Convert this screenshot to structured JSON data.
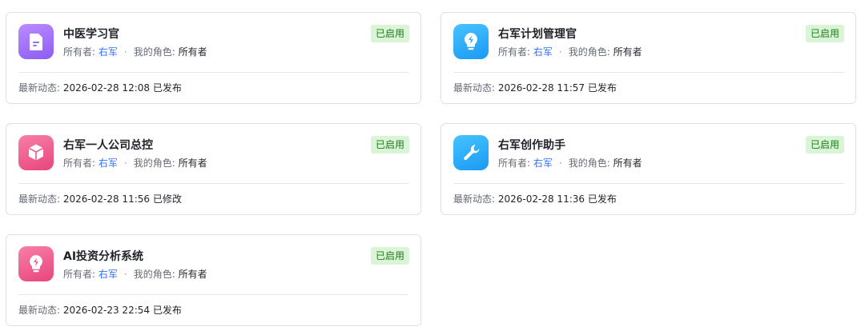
{
  "cards": [
    {
      "title": "中医学习官",
      "status": "已启用",
      "owner_label": "所有者:",
      "owner": "右军",
      "separator": "·",
      "role_label": "我的角色:",
      "role": "所有者",
      "activity_label": "最新动态:",
      "activity": "2026-02-28 12:08 已发布",
      "icon": "document-icon",
      "icon_color": "#9b6cf8"
    },
    {
      "title": "右军计划管理官",
      "status": "已启用",
      "owner_label": "所有者:",
      "owner": "右军",
      "separator": "·",
      "role_label": "我的角色:",
      "role": "所有者",
      "activity_label": "最新动态:",
      "activity": "2026-02-28 11:57 已发布",
      "icon": "lightbulb-icon",
      "icon_color": "#2aaaf8"
    },
    {
      "title": "右军一人公司总控",
      "status": "已启用",
      "owner_label": "所有者:",
      "owner": "右军",
      "separator": "·",
      "role_label": "我的角色:",
      "role": "所有者",
      "activity_label": "最新动态:",
      "activity": "2026-02-28 11:56 已修改",
      "icon": "cube-icon",
      "icon_color": "#ee5a8c"
    },
    {
      "title": "右军创作助手",
      "status": "已启用",
      "owner_label": "所有者:",
      "owner": "右军",
      "separator": "·",
      "role_label": "我的角色:",
      "role": "所有者",
      "activity_label": "最新动态:",
      "activity": "2026-02-28 11:36 已发布",
      "icon": "wrench-icon",
      "icon_color": "#2aaaf8"
    },
    {
      "title": "AI投资分析系统",
      "status": "已启用",
      "owner_label": "所有者:",
      "owner": "右军",
      "separator": "·",
      "role_label": "我的角色:",
      "role": "所有者",
      "activity_label": "最新动态:",
      "activity": "2026-02-23 22:54 已发布",
      "icon": "lightbulb-icon",
      "icon_color": "#ee5a8c"
    }
  ],
  "colors": {
    "badge_bg": "#d9f5d6",
    "badge_text": "#1f7a1f",
    "link": "#3370ff",
    "border": "#dee0e3"
  }
}
